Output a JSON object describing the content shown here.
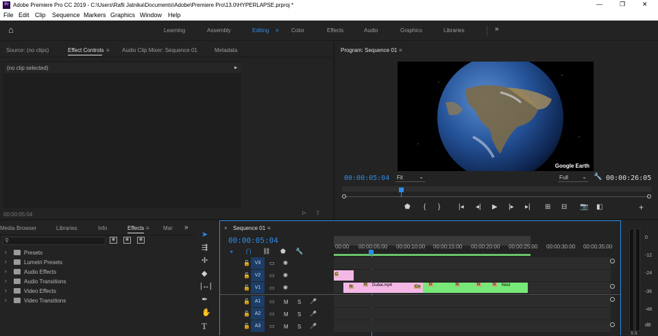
{
  "titlebar": {
    "app_icon": "Pr",
    "title": "Adobe Premiere Pro CC 2019 - C:\\Users\\Rafli Jatnika\\Documents\\Adobe\\Premiere Pro\\13.0\\HYPERLAPSE.prproj *",
    "minimize": "—",
    "maximize": "❐",
    "close": "✕"
  },
  "menu": [
    "File",
    "Edit",
    "Clip",
    "Sequence",
    "Markers",
    "Graphics",
    "Window",
    "Help"
  ],
  "workspaces": {
    "home": "⌂",
    "items": [
      "Learning",
      "Assembly",
      "Editing",
      "Color",
      "Effects",
      "Audio",
      "Graphics",
      "Libraries"
    ],
    "active": "Editing",
    "editing_menu": "≡",
    "more": "»"
  },
  "source_panel": {
    "tabs": [
      "Source: (no clips)",
      "Effect Controls",
      "Audio Clip Mixer: Sequence 01",
      "Metadata"
    ],
    "active_tab": "Effect Controls",
    "no_clip": "(no clip selected)",
    "expand": "▸",
    "timecode": "00:00:05:04"
  },
  "program_panel": {
    "title": "Program: Sequence 01",
    "menu": "≡",
    "timecode": "00:00:05:04",
    "fit": "Fit",
    "quality": "Full",
    "duration": "00:00:26:05",
    "watermark": "Google Earth",
    "controls": [
      "mark-in",
      "mark-in-bracket",
      "mark-out-bracket",
      "go-to-in",
      "step-back",
      "play",
      "step-forward",
      "go-to-out",
      "lift",
      "extract",
      "insert",
      "overwrite",
      "export-frame",
      "comparison",
      "add"
    ]
  },
  "project_panel": {
    "tabs": [
      "Media Browser",
      "Libraries",
      "Info",
      "Effects",
      "Mar"
    ],
    "active_tab": "Effects",
    "more": "»",
    "search_placeholder": "",
    "folders": [
      "Presets",
      "Lumetri Presets",
      "Audio Effects",
      "Audio Transitions",
      "Video Effects",
      "Video Transitions"
    ]
  },
  "timeline": {
    "close": "×",
    "tab": "Sequence 01",
    "menu": "≡",
    "timecode": "00:00:05:04",
    "ruler": [
      "00:00",
      "00:00:05:00",
      "00:00:10:00",
      "00:00:15:00",
      "00:00:20:00",
      "00:00:25:00",
      "00:00:30:00",
      "00:00:35:00"
    ],
    "tracks": [
      {
        "name": "V3",
        "kind": "video"
      },
      {
        "name": "V2",
        "kind": "video"
      },
      {
        "name": "V1",
        "kind": "video"
      },
      {
        "name": "A1",
        "kind": "audio"
      },
      {
        "name": "A2",
        "kind": "audio"
      },
      {
        "name": "A3",
        "kind": "audio"
      }
    ],
    "track_mute": "M",
    "track_solo": "S",
    "clips": {
      "v2_clip": "C",
      "v1_fx1": "fx",
      "v1_clip1": "Dubai.mp4",
      "v1_clip2": "Co",
      "v1_nest": "Nest"
    },
    "colors": {
      "clip_pink": "#f4b8e6",
      "clip_green": "#78e878",
      "playhead": "#2d8ceb"
    }
  },
  "meter": {
    "labels": [
      "0",
      "-12",
      "-24",
      "-36",
      "-48",
      "dB"
    ],
    "bottom": "S S"
  },
  "tools": [
    "selection",
    "track-select",
    "ripple-edit",
    "razor",
    "slip",
    "pen",
    "hand",
    "type"
  ]
}
